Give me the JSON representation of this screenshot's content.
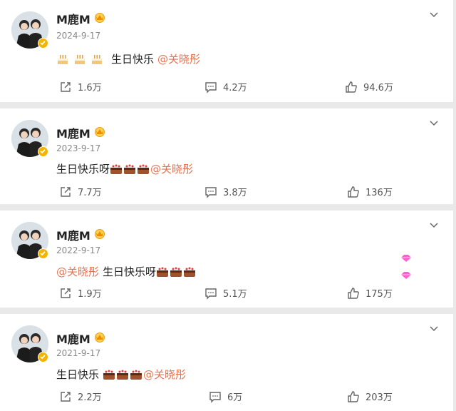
{
  "posts": [
    {
      "author": "M鹿M",
      "date": "2024-9-17",
      "text_before": "",
      "text_after": "生日快乐",
      "mention": "@关晓彤",
      "emoji": "birthday-cake",
      "emoji_count": 3,
      "layout": "cakes-text-mention",
      "reposts": "1.6万",
      "comments": "4.2万",
      "likes": "94.6万"
    },
    {
      "author": "M鹿M",
      "date": "2023-9-17",
      "text_before": "生日快乐呀",
      "text_after": "",
      "mention": "@关晓彤",
      "emoji": "birthday-cake",
      "emoji_count": 3,
      "layout": "text-cakes-mention",
      "reposts": "7.7万",
      "comments": "3.8万",
      "likes": "136万"
    },
    {
      "author": "M鹿M",
      "date": "2022-9-17",
      "text_before": "",
      "text_after": "生日快乐呀",
      "mention": "@关晓彤",
      "emoji": "birthday-cake",
      "emoji_count": 3,
      "layout": "mention-text-cakes",
      "reposts": "1.9万",
      "comments": "5.1万",
      "likes": "175万"
    },
    {
      "author": "M鹿M",
      "date": "2021-9-17",
      "text_before": "生日快乐",
      "text_after": "",
      "mention": "@关晓彤",
      "emoji": "birthday-cake",
      "emoji_count": 3,
      "layout": "text-cakes-mention",
      "reposts": "2.2万",
      "comments": "6万",
      "likes": "203万"
    }
  ],
  "colors": {
    "mention": "#eb7350",
    "verified_badge": "#f5b400",
    "background": "#e9e9e9",
    "card": "#ffffff"
  },
  "icons": [
    "avatar",
    "verified-badge-icon",
    "crown-icon",
    "chevron-down-icon",
    "repost-icon",
    "comment-icon",
    "like-icon",
    "birthday-cake-icon",
    "gem-icon"
  ]
}
